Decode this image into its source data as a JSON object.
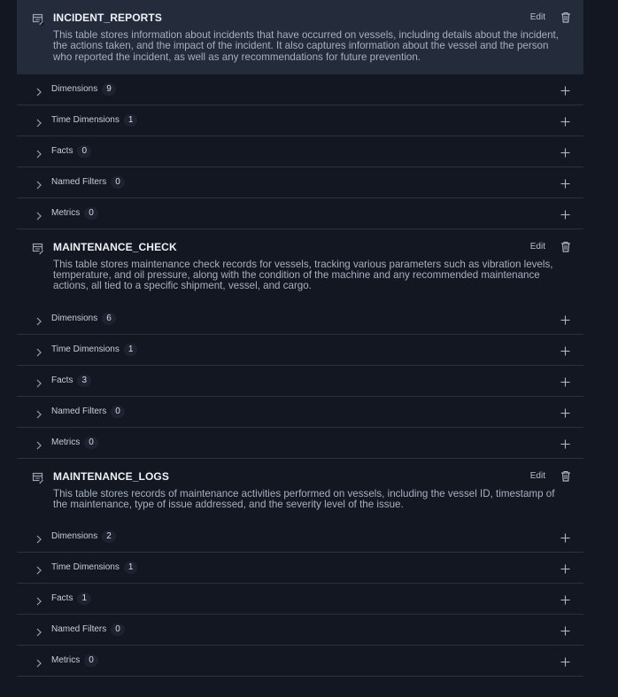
{
  "tables": [
    {
      "name": "INCIDENT_REPORTS",
      "description": "This table stores information about incidents that have occurred on vessels, including details about the incident, the actions taken, and the impact of the incident. It also captures information about the vessel and the person who reported the incident, as well as any recommendations for future prevention.",
      "edit_label": "Edit",
      "sections": [
        {
          "label": "Dimensions",
          "count": "9"
        },
        {
          "label": "Time Dimensions",
          "count": "1"
        },
        {
          "label": "Facts",
          "count": "0"
        },
        {
          "label": "Named Filters",
          "count": "0"
        },
        {
          "label": "Metrics",
          "count": "0"
        }
      ]
    },
    {
      "name": "MAINTENANCE_CHECK",
      "description": "This table stores maintenance check records for vessels, tracking various parameters such as vibration levels, temperature, and oil pressure, along with the condition of the machine and any recommended maintenance actions, all tied to a specific shipment, vessel, and cargo.",
      "edit_label": "Edit",
      "sections": [
        {
          "label": "Dimensions",
          "count": "6"
        },
        {
          "label": "Time Dimensions",
          "count": "1"
        },
        {
          "label": "Facts",
          "count": "3"
        },
        {
          "label": "Named Filters",
          "count": "0"
        },
        {
          "label": "Metrics",
          "count": "0"
        }
      ]
    },
    {
      "name": "MAINTENANCE_LOGS",
      "description": "This table stores records of maintenance activities performed on vessels, including the vessel ID, timestamp of the maintenance, type of issue addressed, and the severity level of the issue.",
      "edit_label": "Edit",
      "sections": [
        {
          "label": "Dimensions",
          "count": "2"
        },
        {
          "label": "Time Dimensions",
          "count": "1"
        },
        {
          "label": "Facts",
          "count": "1"
        },
        {
          "label": "Named Filters",
          "count": "0"
        },
        {
          "label": "Metrics",
          "count": "0"
        }
      ]
    }
  ],
  "icons": {
    "table": "table-icon",
    "delete": "trash-icon",
    "expand": "chevron-right-icon",
    "add": "plus-icon"
  },
  "colors": {
    "background": "#131722",
    "selected_header": "#242c3c",
    "divider": "#2a3140"
  }
}
